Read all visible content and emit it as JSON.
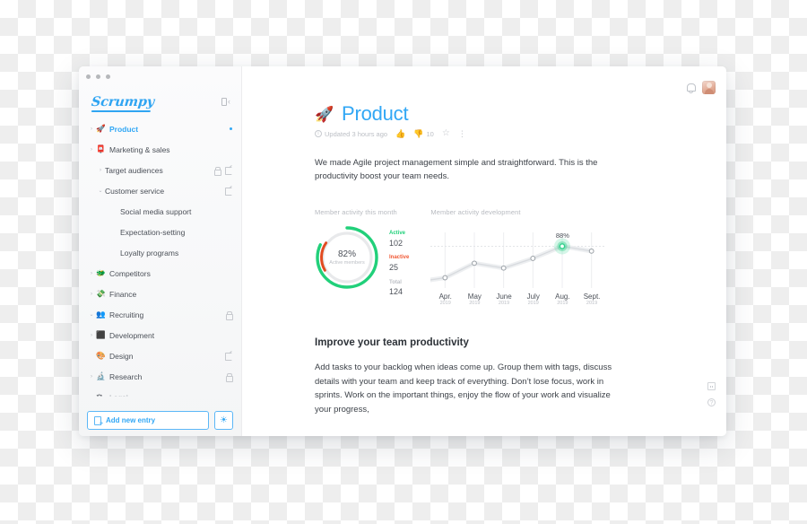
{
  "window": {
    "traffic_lights": [
      "close",
      "minimize",
      "maximize"
    ]
  },
  "sidebar": {
    "logo": "Scrumpy",
    "collapse_icon": "panel-collapse-icon",
    "items": [
      {
        "label": "Product",
        "emoji": "🚀",
        "level": 0,
        "caret": "›",
        "active": true,
        "muted": false,
        "lock": false,
        "edit": false,
        "dot": true
      },
      {
        "label": "Marketing & sales",
        "emoji": "📮",
        "level": 0,
        "caret": "›",
        "active": false,
        "muted": false,
        "lock": false,
        "edit": false,
        "dot": false
      },
      {
        "label": "Target audiences",
        "emoji": "",
        "level": 1,
        "caret": "›",
        "active": false,
        "muted": false,
        "lock": true,
        "edit": true,
        "dot": false
      },
      {
        "label": "Customer service",
        "emoji": "",
        "level": 1,
        "caret": "⌄",
        "active": false,
        "muted": false,
        "lock": false,
        "edit": true,
        "dot": false
      },
      {
        "label": "Social media support",
        "emoji": "",
        "level": 2,
        "caret": "",
        "active": false,
        "muted": false,
        "lock": false,
        "edit": false,
        "dot": false
      },
      {
        "label": "Expectation-setting",
        "emoji": "",
        "level": 2,
        "caret": "",
        "active": false,
        "muted": false,
        "lock": false,
        "edit": false,
        "dot": false
      },
      {
        "label": "Loyalty programs",
        "emoji": "",
        "level": 2,
        "caret": "",
        "active": false,
        "muted": false,
        "lock": false,
        "edit": false,
        "dot": false
      },
      {
        "label": "Competitors",
        "emoji": "🐲",
        "level": 0,
        "caret": "›",
        "active": false,
        "muted": false,
        "lock": false,
        "edit": false,
        "dot": false
      },
      {
        "label": "Finance",
        "emoji": "💸",
        "level": 0,
        "caret": "›",
        "active": false,
        "muted": false,
        "lock": false,
        "edit": false,
        "dot": false
      },
      {
        "label": "Recruiting",
        "emoji": "👥",
        "level": 0,
        "caret": "⌄",
        "active": false,
        "muted": false,
        "lock": true,
        "edit": false,
        "dot": false
      },
      {
        "label": "Development",
        "emoji": "⬛",
        "level": 0,
        "caret": "›",
        "active": false,
        "muted": false,
        "lock": false,
        "edit": false,
        "dot": false
      },
      {
        "label": "Design",
        "emoji": "🎨",
        "level": 0,
        "caret": "",
        "active": false,
        "muted": false,
        "lock": false,
        "edit": true,
        "dot": false
      },
      {
        "label": "Research",
        "emoji": "🔬",
        "level": 0,
        "caret": "›",
        "active": false,
        "muted": false,
        "lock": true,
        "edit": false,
        "dot": false
      },
      {
        "label": "Legal",
        "emoji": "⚖",
        "level": 0,
        "caret": "",
        "active": false,
        "muted": true,
        "lock": false,
        "edit": false,
        "dot": false
      }
    ],
    "footer": {
      "add_entry_label": "Add new entry",
      "add_entry_icon": "new-page-icon",
      "settings_icon": "settings-gear-icon",
      "settings_glyph": "☀"
    }
  },
  "topbar": {
    "notifications_icon": "bell-icon",
    "avatar_icon": "user-avatar"
  },
  "document": {
    "emoji": "🚀",
    "title": "Product",
    "meta": {
      "info_icon": "info-icon",
      "info_glyph": "i",
      "updated": "Updated 3 hours ago",
      "thumbs_up_icon": "thumbs-up-icon",
      "thumbs_up_glyph": "👍",
      "thumbs_down_icon": "thumbs-down-icon",
      "thumbs_down_glyph": "👎",
      "thumbs_down_count": "10",
      "star_icon": "star-outline-icon",
      "star_glyph": "☆",
      "more_icon": "more-vertical-icon",
      "more_glyph": "⋮"
    },
    "lead": "We made Agile project management simple and straightforward. This is the productivity boost your team needs.",
    "section": {
      "heading": "Improve your team productivity",
      "body": "Add tasks to your backlog when ideas come up. Group them with tags, discuss details with your team and keep track of everything. Don’t lose focus, work in sprints. Work on the important things, enjoy the flow of your work and visualize your progress,"
    }
  },
  "side_tools": [
    {
      "name": "keyboard-shortcuts-icon",
      "glyph": ""
    },
    {
      "name": "help-icon",
      "glyph": "?"
    }
  ],
  "chart_data": [
    {
      "type": "pie",
      "variant": "donut",
      "title": "Member activity this month",
      "center_value": "82%",
      "center_label": "Active members",
      "categories": [
        "Active",
        "Inactive"
      ],
      "values": [
        102,
        25
      ],
      "percentages": [
        82,
        18
      ],
      "total_label": "Total",
      "total_value": 124,
      "colors": {
        "active": "#21d07a",
        "inactive": "#e14b20",
        "track": "#e8e9eb"
      },
      "legend": [
        {
          "label": "Active",
          "value": "102",
          "color": "#21d07a"
        },
        {
          "label": "Inactive",
          "value": "25",
          "color": "#f15a36"
        },
        {
          "label": "Total",
          "value": "124",
          "color": "#bdc0c6"
        }
      ],
      "legend_position": "right"
    },
    {
      "type": "line",
      "title": "Member activity development",
      "categories": [
        "Apr.",
        "May",
        "June",
        "July",
        "Aug.",
        "Sept."
      ],
      "tick_sublabels": [
        "2019",
        "2019",
        "2019",
        "2019",
        "2019",
        "2019"
      ],
      "values": [
        62,
        74,
        70,
        78,
        88,
        84
      ],
      "ylim": [
        55,
        95
      ],
      "grid": true,
      "gridline_at": 88,
      "highlight": {
        "index": 4,
        "label": "88%",
        "color": "#2fd08a"
      },
      "xlabel": "",
      "ylabel": "",
      "line_color": "#d7dade",
      "marker_color": "#9aa0a6"
    }
  ]
}
